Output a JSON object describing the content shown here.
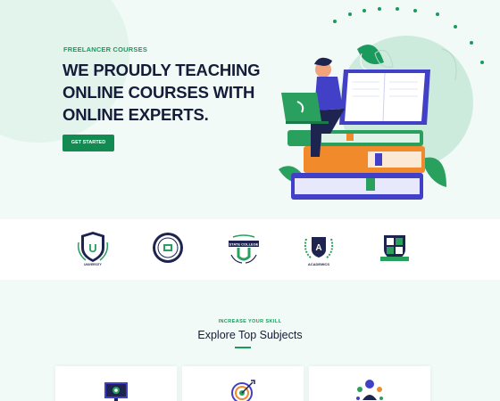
{
  "hero": {
    "eyebrow": "FREELANCER COURSES",
    "headline_lines": [
      "WE PROUDLY TEACHING",
      "ONLINE COURSES WITH",
      "ONLINE EXPERTS."
    ],
    "cta_label": "GET STARTED"
  },
  "logos": [
    {
      "name": "university-logo",
      "text": "UNIVERSITY"
    },
    {
      "name": "circle-seal-logo",
      "text": ""
    },
    {
      "name": "state-college-logo",
      "text": "STATE COLLEGE"
    },
    {
      "name": "academics-logo",
      "text": "ACADEMICS"
    },
    {
      "name": "shield-crest-logo",
      "text": ""
    }
  ],
  "subjects": {
    "eyebrow": "INCREASE YOUR SKILL",
    "title": "Explore Top Subjects"
  },
  "colors": {
    "accent": "#138a52",
    "heading": "#151c3a",
    "hero_bg": "#f1faf6",
    "book_blue": "#4340c8",
    "book_green": "#2aa05e",
    "book_orange": "#f08a2b"
  }
}
